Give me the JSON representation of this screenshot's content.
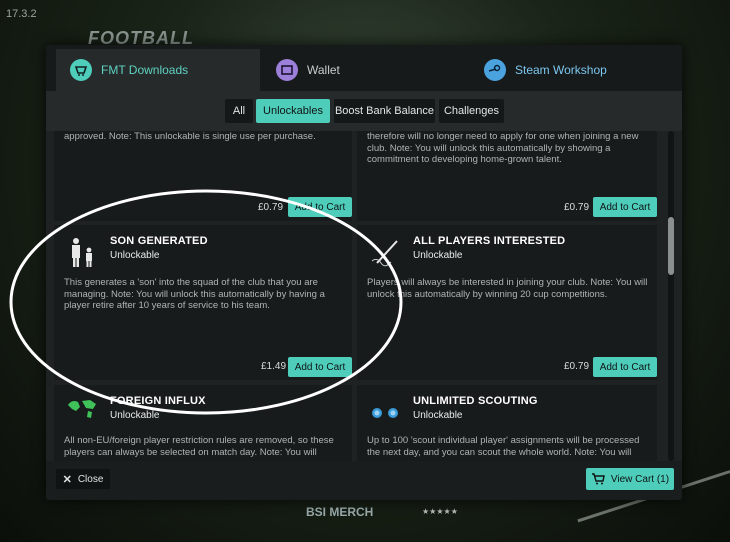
{
  "version": "17.3.2",
  "background": {
    "logo_text": "FOOTBALL",
    "bottom_brand": "BSI MERCH",
    "stars": "★★★★★"
  },
  "tabs": [
    {
      "label": "FMT Downloads",
      "icon": "download-icon"
    },
    {
      "label": "Wallet",
      "icon": "wallet-icon"
    },
    {
      "label": "Steam Workshop",
      "icon": "steam-icon"
    }
  ],
  "filters": [
    {
      "label": "All",
      "active": false
    },
    {
      "label": "Unlockables",
      "active": true
    },
    {
      "label": "Boost Bank Balance",
      "active": false
    },
    {
      "label": "Challenges",
      "active": false
    }
  ],
  "cards": [
    {
      "title": "",
      "subtitle": "",
      "description": "approved. Note: This unlockable is single use per purchase.",
      "price": "£0.79",
      "button": "Add to Cart"
    },
    {
      "title": "",
      "subtitle": "",
      "description": "therefore will no longer need to apply for one when joining a new club. Note: You will unlock this automatically by showing a commitment to developing home-grown talent.",
      "price": "£0.79",
      "button": "Add to Cart"
    },
    {
      "title": "SON GENERATED",
      "subtitle": "Unlockable",
      "icon": "father-son-icon",
      "description": "This generates a 'son' into the squad of the club that you are managing. Note: You will unlock this automatically by having a player retire after 10 years of service to his team.",
      "price": "£1.49",
      "button": "Add to Cart"
    },
    {
      "title": "ALL PLAYERS INTERESTED",
      "subtitle": "Unlockable",
      "icon": "pen-signature-icon",
      "description": "Players will always be interested in joining your club. Note: You will unlock this automatically by winning 20 cup competitions.",
      "price": "£0.79",
      "button": "Add to Cart"
    },
    {
      "title": "FOREIGN INFLUX",
      "subtitle": "Unlockable",
      "icon": "world-map-icon",
      "description": "All non-EU/foreign player restriction rules are removed, so these players can always be selected on match day. Note: You will",
      "price": "",
      "button": ""
    },
    {
      "title": "UNLIMITED SCOUTING",
      "subtitle": "Unlockable",
      "icon": "binoculars-icon",
      "description": "Up to 100 'scout individual player' assignments will be processed the next day, and you can scout the whole world. Note: You will",
      "price": "",
      "button": ""
    }
  ],
  "footer": {
    "close_label": "Close",
    "view_cart_label": "View Cart (1)"
  },
  "colors": {
    "accent": "#4ecdbb",
    "annotation": "#ffffff"
  }
}
